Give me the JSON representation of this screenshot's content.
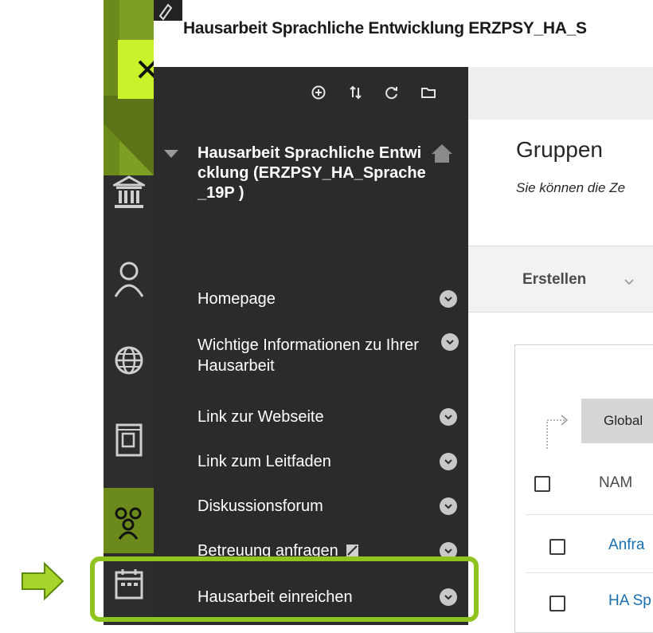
{
  "window": {
    "title": "Hausarbeit Sprachliche Entwicklung ERZPSY_HA_S"
  },
  "rail": {
    "close_label": "×",
    "icons": [
      "institution-icon",
      "user-icon",
      "globe-icon",
      "courses-icon",
      "groups-icon",
      "calendar-icon"
    ]
  },
  "menu": {
    "toolbar_icons": [
      "add-icon",
      "reorder-icon",
      "refresh-icon",
      "folder-icon"
    ],
    "course_title": "Hausarbeit Sprachliche Entwicklung (ERZPSY_HA_Sprache_19P )",
    "items": [
      {
        "label": "Homepage"
      },
      {
        "label": "Wichtige Informationen zu Ihrer Hausarbeit"
      },
      {
        "label": "Link zur Webseite"
      },
      {
        "label": "Link zum Leitfaden"
      },
      {
        "label": "Diskussionsforum"
      },
      {
        "label": "Betreuung anfragen"
      },
      {
        "label": "Hausarbeit einreichen"
      }
    ]
  },
  "main": {
    "title": "Gruppen",
    "subtitle": "Sie können die Ze",
    "create_label": "Erstellen",
    "global_label": "Global",
    "table": {
      "header": "NAM",
      "rows": [
        {
          "name": "Anfra"
        },
        {
          "name": "HA Sp"
        }
      ]
    }
  },
  "colors": {
    "accent_green": "#6c8a1c",
    "close_button": "#c9f22b",
    "highlight": "#8fc31f",
    "link": "#1a6fb0"
  }
}
